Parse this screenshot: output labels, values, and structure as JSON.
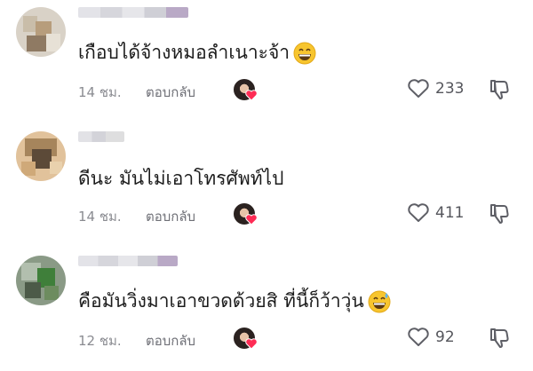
{
  "comments": [
    {
      "text": "เกือบได้จ้างหมอลำเนาะจ้า",
      "time": "14 ชม.",
      "reply_label": "ตอบกลับ",
      "likes": "233",
      "emoji": "grinning-face"
    },
    {
      "text": "ดีนะ มันไม่เอาโทรศัพท์ไป",
      "time": "14 ชม.",
      "reply_label": "ตอบกลับ",
      "likes": "411",
      "emoji": ""
    },
    {
      "text": "คือมันวิ่งมาเอาขวดด้วยสิ ที่นี้ก็ว้าวุ่น",
      "time": "12 ชม.",
      "reply_label": "ตอบกลับ",
      "likes": "92",
      "emoji": "grinning-face-with-sweat"
    }
  ],
  "colors": {
    "heart": "#fe2c55",
    "text": "#1c1c1c",
    "meta": "#8a8b91"
  }
}
